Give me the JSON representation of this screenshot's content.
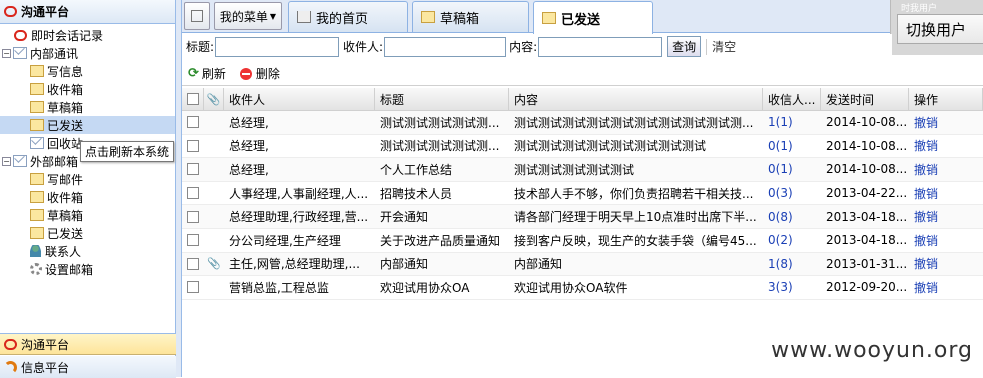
{
  "left": {
    "title": "沟通平台",
    "tree": [
      {
        "label": "即时会话记录",
        "level": 0,
        "icon": "bubble-icon"
      },
      {
        "label": "内部通讯",
        "level": 0,
        "icon": "envelope-icon",
        "expander": "−"
      },
      {
        "label": "写信息",
        "level": 1,
        "icon": "write-mail-icon"
      },
      {
        "label": "收件箱",
        "level": 1,
        "icon": "inbox-icon"
      },
      {
        "label": "草稿箱",
        "level": 1,
        "icon": "drafts-icon"
      },
      {
        "label": "已发送",
        "level": 1,
        "icon": "sent-icon",
        "selected": true
      },
      {
        "label": "回收站",
        "level": 1,
        "icon": "recycle-icon"
      },
      {
        "label": "外部邮箱",
        "level": 0,
        "icon": "envelope-icon",
        "expander": "−"
      },
      {
        "label": "写邮件",
        "level": 1,
        "icon": "write-mail-icon"
      },
      {
        "label": "收件箱",
        "level": 1,
        "icon": "inbox-icon"
      },
      {
        "label": "草稿箱",
        "level": 1,
        "icon": "drafts-icon"
      },
      {
        "label": "已发送",
        "level": 1,
        "icon": "sent-icon"
      },
      {
        "label": "联系人",
        "level": 1,
        "icon": "contacts-icon"
      },
      {
        "label": "设置邮箱",
        "level": 1,
        "icon": "gear-icon"
      }
    ],
    "tooltip": "点击刷新本系统",
    "bottom_panels": [
      "沟通平台",
      "信息平台"
    ]
  },
  "tabs": {
    "menu_button": "我的菜单",
    "items": [
      "我的首页",
      "草稿箱",
      "已发送"
    ],
    "switch_faint": "时我用户",
    "switch_user": "切换用户"
  },
  "search": {
    "title_label": "标题:",
    "receiver_label": "收件人:",
    "content_label": "内容:",
    "query_button": "查询",
    "clear_button": "清空"
  },
  "toolbar": {
    "refresh": "刷新",
    "delete": "删除"
  },
  "grid": {
    "headers": [
      "收件人",
      "标题",
      "内容",
      "收信人...",
      "发送时间",
      "操作"
    ],
    "rows": [
      {
        "receiver": "总经理,",
        "title": "测试测试测试测试测...",
        "content": "测试测试测试测试测试测试测试测试测试测...",
        "count": "1(1)",
        "time": "2014-10-08...",
        "action": "撤销",
        "attach": false
      },
      {
        "receiver": "总经理,",
        "title": "测试测试测试测试测...",
        "content": "测试测试测试测试测试测试测试测试",
        "count": "0(1)",
        "time": "2014-10-08...",
        "action": "撤销",
        "attach": false
      },
      {
        "receiver": "总经理,",
        "title": "个人工作总结",
        "content": "测试测试测试测试测试",
        "count": "0(1)",
        "time": "2014-10-08...",
        "action": "撤销",
        "attach": false
      },
      {
        "receiver": "人事经理,人事副经理,人...",
        "title": "招聘技术人员",
        "content": "技术部人手不够，你们负责招聘若干相关技...",
        "count": "0(3)",
        "time": "2013-04-22...",
        "action": "撤销",
        "attach": false
      },
      {
        "receiver": "总经理助理,行政经理,营...",
        "title": "开会通知",
        "content": "请各部门经理于明天早上10点准时出席下半...",
        "count": "0(8)",
        "time": "2013-04-18...",
        "action": "撤销",
        "attach": false
      },
      {
        "receiver": "分公司经理,生产经理",
        "title": "关于改进产品质量通知",
        "content": "接到客户反映，现生产的女装手袋（编号45...",
        "count": "0(2)",
        "time": "2013-04-18...",
        "action": "撤销",
        "attach": false
      },
      {
        "receiver": "主任,网管,总经理助理,...",
        "title": "内部通知",
        "content": "内部通知",
        "count": "1(8)",
        "time": "2013-01-31...",
        "action": "撤销",
        "attach": true
      },
      {
        "receiver": "营销总监,工程总监",
        "title": "欢迎试用协众OA",
        "content": "欢迎试用协众OA软件",
        "count": "3(3)",
        "time": "2012-09-20...",
        "action": "撤销",
        "attach": false
      }
    ]
  },
  "watermark": "www.wooyun.org"
}
